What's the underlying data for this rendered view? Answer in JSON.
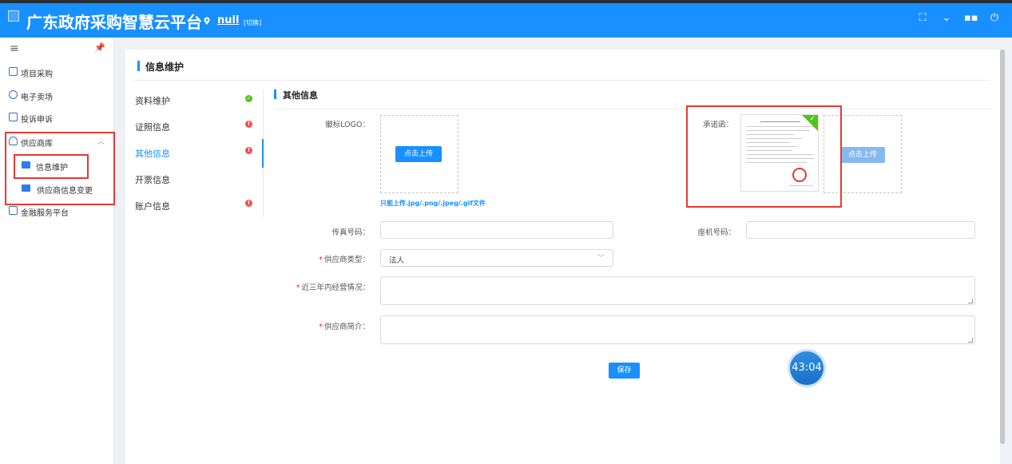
{
  "header": {
    "title": "广东政府采购智慧云平台",
    "location": "null",
    "switch_label": "[切换]"
  },
  "sidebar": {
    "items": [
      {
        "label": "项目采购",
        "icon": "shield-icon"
      },
      {
        "label": "电子卖场",
        "icon": "store-icon"
      },
      {
        "label": "投诉申诉",
        "icon": "complaint-icon"
      },
      {
        "label": "供应商库",
        "icon": "user-icon"
      },
      {
        "label": "金融服务平台",
        "icon": "finance-icon"
      }
    ],
    "subitems": [
      {
        "label": "信息维护"
      },
      {
        "label": "供应商信息变更"
      }
    ]
  },
  "main": {
    "page_title": "信息维护",
    "tabs": [
      {
        "label": "资料维护",
        "status": "ok"
      },
      {
        "label": "证照信息",
        "status": "error"
      },
      {
        "label": "其他信息",
        "status": "error"
      },
      {
        "label": "开票信息",
        "status": "none"
      },
      {
        "label": "账户信息",
        "status": "error"
      }
    ],
    "section_title": "其他信息",
    "form": {
      "logo_label": "徽标LOGO：",
      "upload_button": "点击上传",
      "upload_hint": "只能上传.jpg/.png/.jpeg/.gif文件",
      "promise_label": "承诺函：",
      "promise_upload_button": "点击上传",
      "fax_label": "传真号码：",
      "phone_label": "座机号码：",
      "type_label": "供应商类型：",
      "type_value": "法人",
      "ops_label": "近三年内经营情况：",
      "intro_label": "供应商简介：",
      "save_button": "保存"
    }
  },
  "timer": "43:04",
  "colors": {
    "primary": "#1890ff",
    "highlight": "#e53935",
    "ok": "#52c41a",
    "error": "#ef5350"
  }
}
